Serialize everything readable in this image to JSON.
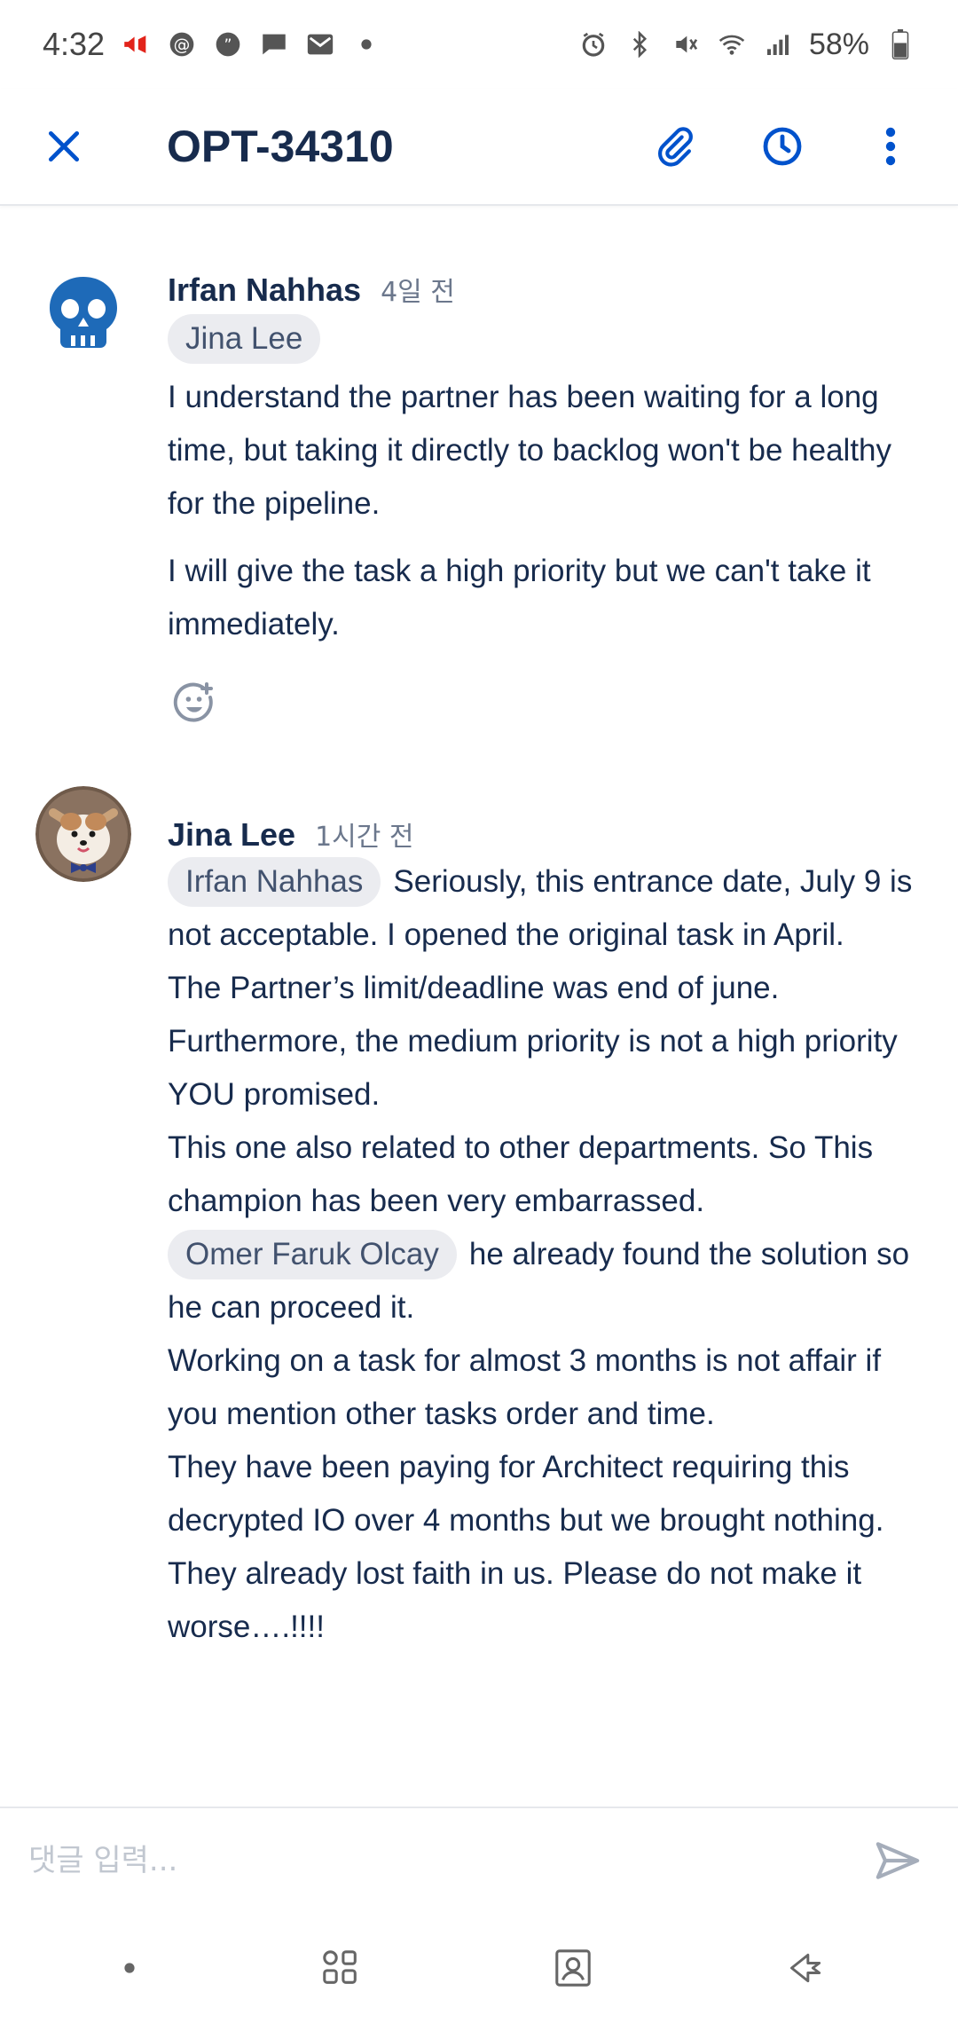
{
  "status_bar": {
    "time": "4:32",
    "battery": "58%",
    "left_icons": [
      "megaphone-icon",
      "threads-icon",
      "chat-bubble-icon",
      "message-icon",
      "gmail-icon",
      "dot-icon"
    ],
    "right_icons": [
      "alarm-icon",
      "bluetooth-icon",
      "mute-icon",
      "wifi-icon",
      "signal-icon",
      "battery-icon"
    ]
  },
  "header": {
    "title": "OPT-34310",
    "actions": [
      "attachment-icon",
      "history-icon",
      "more-icon"
    ]
  },
  "comments": [
    {
      "author": "Irfan Nahhas",
      "time": "4일 전",
      "mention": "Jina Lee",
      "paragraphs": [
        "I understand the partner has been waiting for a long time, but taking it directly to backlog won't be healthy for the pipeline.",
        "I will give the task a high priority but we can't take it immediately."
      ]
    },
    {
      "author": "Jina Lee",
      "time": "1시간 전",
      "mention": "Irfan Nahhas",
      "text_a": "Seriously, this entrance date, July 9 is not acceptable. I opened the original task in April.",
      "text_b": "The Partner’s limit/deadline was end of june.",
      "text_c": "Furthermore, the medium priority is not a high priority YOU promised.",
      "text_d": "This one also related to other departments. So This champion has been very embarrassed.",
      "mention2": "Omer Faruk Olcay",
      "text_e": "he already found the solution so he can proceed it.",
      "text_f": "Working on a task for almost 3 months is not affair if you mention other tasks order and time.",
      "text_g": "They have been paying for Architect requiring this decrypted IO over 4 months but we brought nothing.",
      "text_h": "They already lost faith in us. Please do not make it worse….!!!!"
    }
  ],
  "composer": {
    "placeholder": "댓글 입력..."
  },
  "colors": {
    "brand_blue": "#0052cc",
    "text": "#172b4d",
    "mention_bg": "#ebecf0",
    "notification_red": "#e2231a"
  }
}
